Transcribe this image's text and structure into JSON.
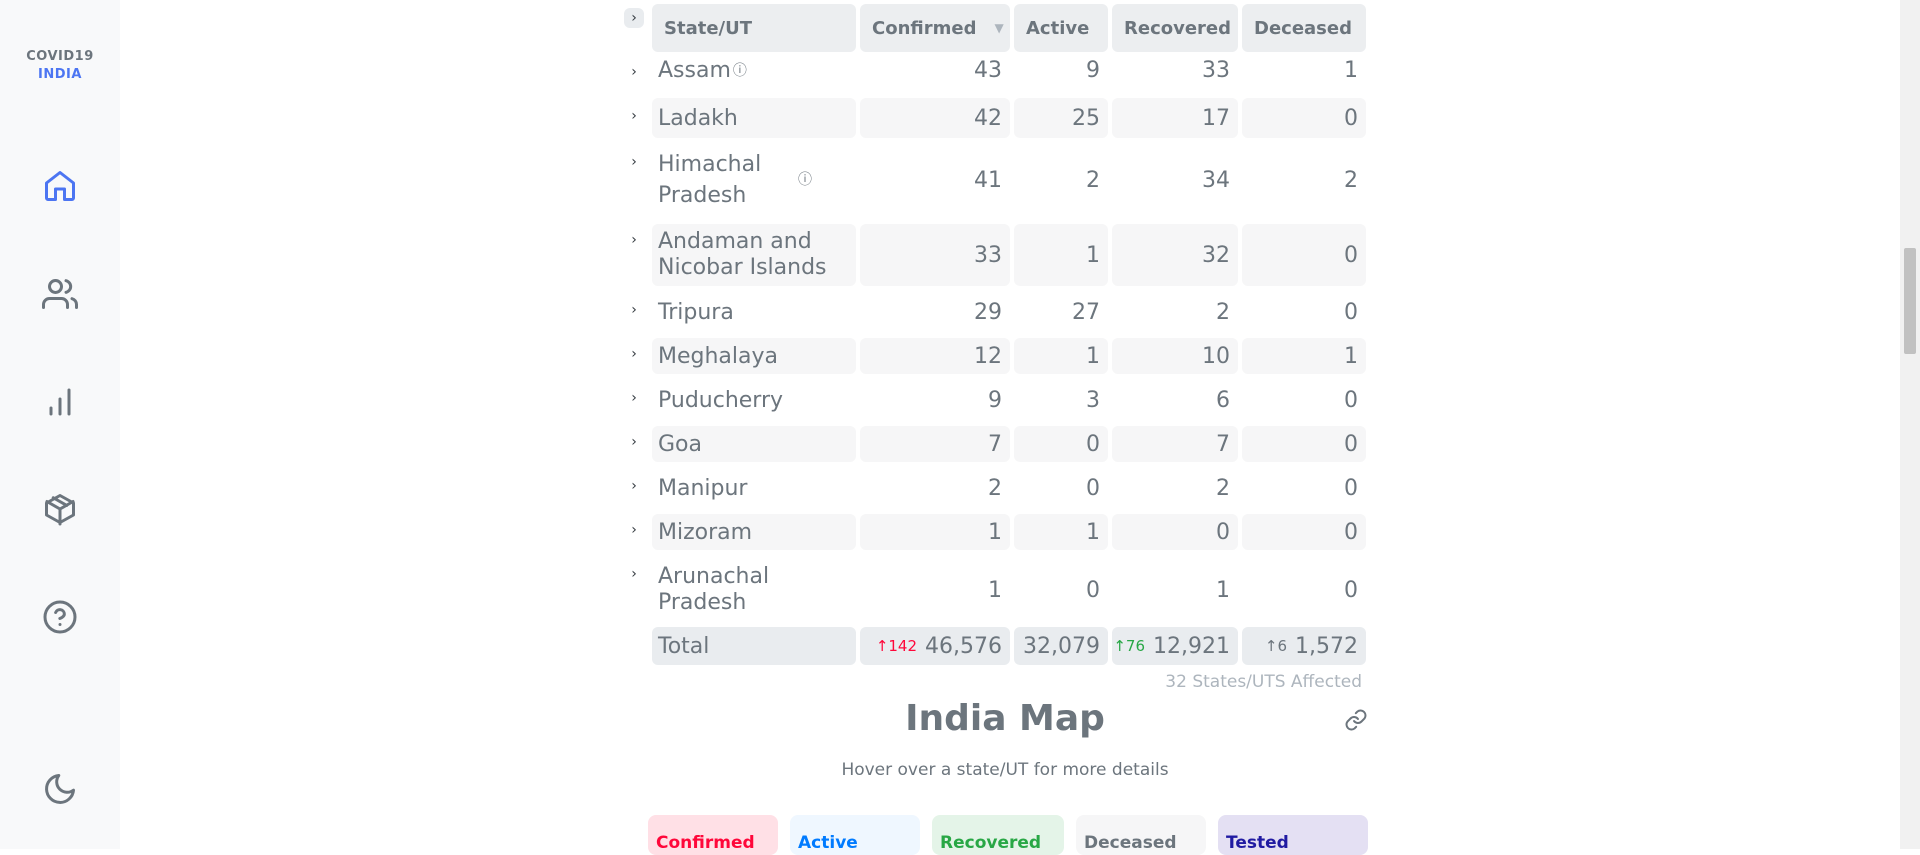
{
  "brand": {
    "line1": "COVID19",
    "line2": "INDIA"
  },
  "nav": [
    {
      "name": "home",
      "icon": "home-icon"
    },
    {
      "name": "users",
      "icon": "users-icon"
    },
    {
      "name": "charts",
      "icon": "bar-chart-icon"
    },
    {
      "name": "resources",
      "icon": "package-icon"
    },
    {
      "name": "help",
      "icon": "help-circle-icon"
    },
    {
      "name": "theme",
      "icon": "moon-icon"
    }
  ],
  "table": {
    "headers": {
      "state": "State/UT",
      "confirmed": "Confirmed",
      "active": "Active",
      "recovered": "Recovered",
      "deceased": "Deceased"
    },
    "rows": [
      {
        "state": "Assam",
        "confirmed": "43",
        "active": "9",
        "recovered": "33",
        "deceased": "1"
      },
      {
        "state": "Ladakh",
        "confirmed": "42",
        "active": "25",
        "recovered": "17",
        "deceased": "0"
      },
      {
        "state": "Himachal Pradesh",
        "confirmed": "41",
        "active": "2",
        "recovered": "34",
        "deceased": "2"
      },
      {
        "state": "Andaman and Nicobar Islands",
        "confirmed": "33",
        "active": "1",
        "recovered": "32",
        "deceased": "0"
      },
      {
        "state": "Tripura",
        "confirmed": "29",
        "active": "27",
        "recovered": "2",
        "deceased": "0"
      },
      {
        "state": "Meghalaya",
        "confirmed": "12",
        "active": "1",
        "recovered": "10",
        "deceased": "1"
      },
      {
        "state": "Puducherry",
        "confirmed": "9",
        "active": "3",
        "recovered": "6",
        "deceased": "0"
      },
      {
        "state": "Goa",
        "confirmed": "7",
        "active": "0",
        "recovered": "7",
        "deceased": "0"
      },
      {
        "state": "Manipur",
        "confirmed": "2",
        "active": "0",
        "recovered": "2",
        "deceased": "0"
      },
      {
        "state": "Mizoram",
        "confirmed": "1",
        "active": "1",
        "recovered": "0",
        "deceased": "0"
      },
      {
        "state": "Arunachal Pradesh",
        "confirmed": "1",
        "active": "0",
        "recovered": "1",
        "deceased": "0"
      }
    ],
    "total": {
      "label": "Total",
      "confirmed": "46,576",
      "confirmed_delta": "↑142",
      "active": "32,079",
      "recovered": "12,921",
      "recovered_delta": "↑76",
      "deceased": "1,572",
      "deceased_delta": "↑6"
    },
    "affected": "32 States/UTS Affected"
  },
  "map": {
    "title": "India Map",
    "subtitle": "Hover over a state/UT for more details",
    "tabs": {
      "confirmed": "Confirmed",
      "active": "Active",
      "recovered": "Recovered",
      "deceased": "Deceased",
      "tested": "Tested"
    }
  },
  "colors": {
    "accent": "#4c75f2",
    "confirmed": "#ff073a",
    "recovered": "#28a745",
    "text": "#6c757d"
  }
}
